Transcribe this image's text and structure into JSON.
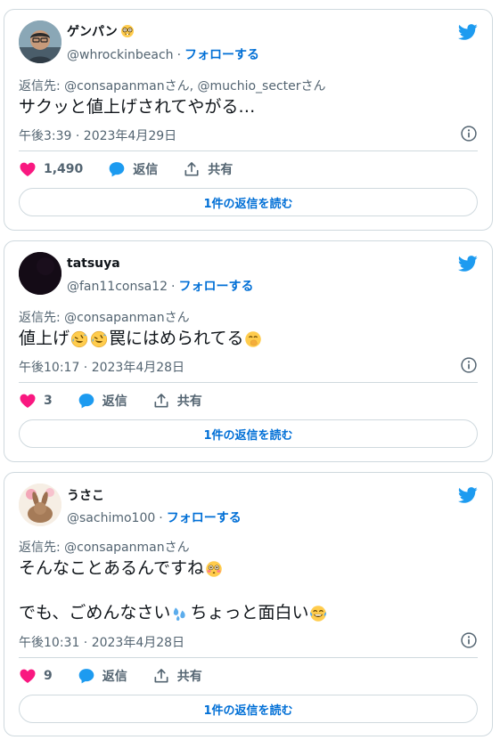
{
  "colors": {
    "link": "#006fd6",
    "heart": "#f91880",
    "reply": "#1d9bf0",
    "border": "#cfd9de",
    "muted": "#536471"
  },
  "tweets": [
    {
      "name": "ゲンパン",
      "name_emoji": "nerd-face-icon",
      "handle": "@whrockinbeach",
      "follow": "フォローする",
      "reply_to": "返信先: @consapanmanさん, @muchio_secterさん",
      "body": "サクッと値上げされてやがる…",
      "time": "午後3:39 · 2023年4月29日",
      "likes": "1,490",
      "reply_label": "返信",
      "share_label": "共有",
      "read_more": "1件の返信を読む"
    },
    {
      "name": "tatsuya",
      "handle": "@fan11consa12",
      "follow": "フォローする",
      "reply_to": "返信先: @consapanmanさん",
      "body_a": "値上げ",
      "body_b": "罠にはめられてる",
      "body_emojis": [
        "rofl-icon",
        "rofl-icon",
        "hand-over-mouth-icon"
      ],
      "time": "午後10:17 · 2023年4月28日",
      "likes": "3",
      "reply_label": "返信",
      "share_label": "共有",
      "read_more": "1件の返信を読む"
    },
    {
      "name": "うさこ",
      "handle": "@sachimo100",
      "follow": "フォローする",
      "reply_to": "返信先: @consapanmanさん",
      "body_line1": "そんなことあるんですね",
      "body_line2_a": "でも、ごめんなさい",
      "body_line2_b": "ちょっと面白い",
      "body_emojis": [
        "flushed-face-icon",
        "sweat-droplets-icon",
        "tears-of-joy-icon"
      ],
      "time": "午後10:31 · 2023年4月28日",
      "likes": "9",
      "reply_label": "返信",
      "share_label": "共有",
      "read_more": "1件の返信を読む"
    }
  ]
}
